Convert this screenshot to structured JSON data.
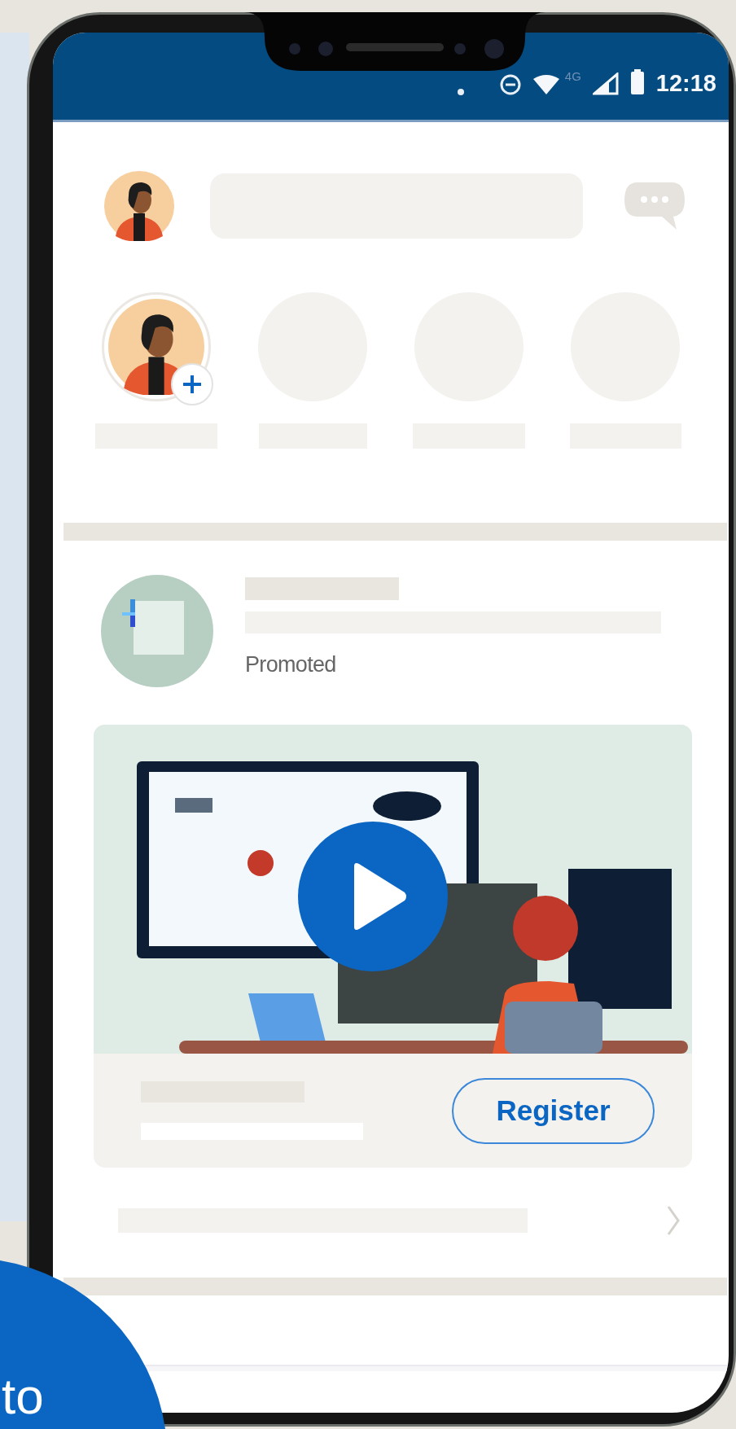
{
  "status_bar": {
    "network": "4G",
    "time": "12:18"
  },
  "stories": [
    {
      "kind": "own"
    },
    {
      "kind": "empty"
    },
    {
      "kind": "empty"
    },
    {
      "kind": "empty"
    }
  ],
  "post": {
    "label": "Promoted",
    "button": "Register"
  },
  "corner_badge": {
    "text": "to"
  }
}
